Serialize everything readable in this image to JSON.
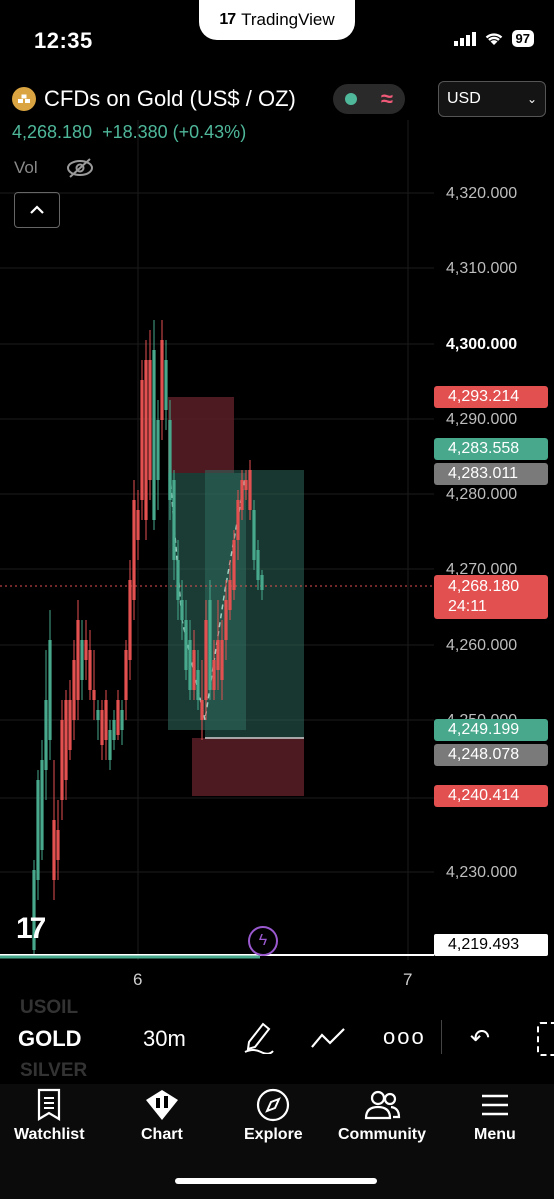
{
  "status_bar": {
    "time": "12:35",
    "app_label": "TradingView",
    "battery": "97"
  },
  "header": {
    "symbol_title": "CFDs on Gold (US$ / OZ)",
    "currency": "USD",
    "last_price": "4,268.180",
    "change": "+18.380 (+0.43%)",
    "vol_label": "Vol"
  },
  "chart": {
    "price_ticks": [
      "4,320.000",
      "4,310.000",
      "4,300.000",
      "4,290.000",
      "4,280.000",
      "4,270.000",
      "4,260.000",
      "4,250.000",
      "4,230.000"
    ],
    "price_tags": {
      "stop_high": "4,293.214",
      "entry_high": "4,283.558",
      "level_grey_1": "4,283.011",
      "current_price": "4,268.180",
      "countdown": "24:11",
      "entry_low": "4,249.199",
      "level_grey_2": "4,248.078",
      "stop_low": "4,240.414",
      "crosshair": "4,219.493"
    },
    "x_labels": [
      "6",
      "7"
    ],
    "colors": {
      "up": "#47a88c",
      "down": "#e35050",
      "bg": "#000000"
    }
  },
  "symbol_toolbar": {
    "prev_symbol": "USOIL",
    "current_symbol": "GOLD",
    "next_symbol": "SILVER",
    "interval": "30m",
    "more": "ooo"
  },
  "tabbar": {
    "items": [
      {
        "label": "Watchlist",
        "icon": "bookmark-icon"
      },
      {
        "label": "Chart",
        "icon": "chart-icon"
      },
      {
        "label": "Explore",
        "icon": "compass-icon"
      },
      {
        "label": "Community",
        "icon": "people-icon"
      },
      {
        "label": "Menu",
        "icon": "menu-icon"
      }
    ]
  }
}
